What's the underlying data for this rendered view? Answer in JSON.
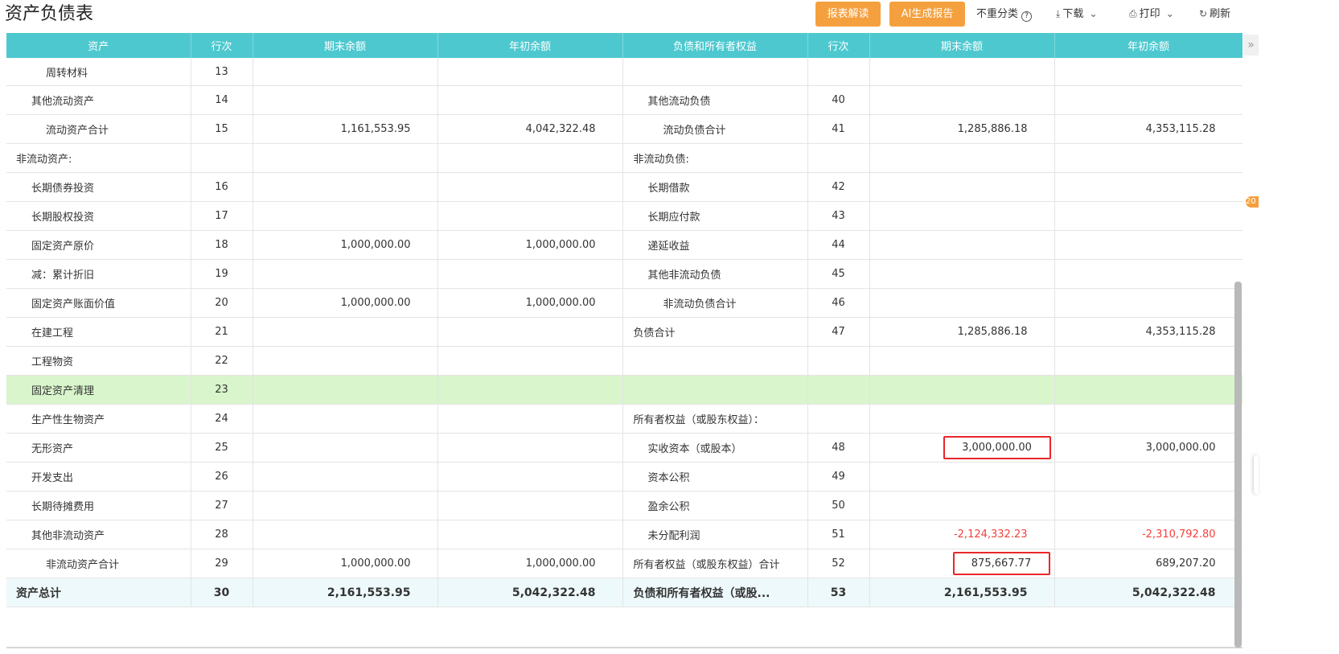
{
  "page": {
    "title": "资产负债表"
  },
  "toolbar": {
    "interpret": "报表解读",
    "ai_report": "AI生成报告",
    "no_reclass": "不重分类",
    "help_glyph": "?",
    "download": "下载",
    "print": "打印",
    "refresh": "刷新"
  },
  "side": {
    "badge": "20"
  },
  "table": {
    "headers": [
      "资产",
      "行次",
      "期末余额",
      "年初余额",
      "负债和所有者权益",
      "行次",
      "期末余额",
      "年初余额"
    ],
    "rows": [
      {
        "a": "周转材料",
        "al": "13",
        "ae": "",
        "ab": "",
        "l": "",
        "ll": "",
        "le": "",
        "lb": ""
      },
      {
        "a": "其他流动资产",
        "al": "14",
        "ae": "",
        "ab": "",
        "l": "其他流动负债",
        "ll": "40",
        "le": "",
        "lb": ""
      },
      {
        "a": "流动资产合计",
        "al": "15",
        "ae": "1,161,553.95",
        "ab": "4,042,322.48",
        "l": "流动负债合计",
        "ll": "41",
        "le": "1,285,886.18",
        "lb": "4,353,115.28"
      },
      {
        "a": "非流动资产:",
        "al": "",
        "ae": "",
        "ab": "",
        "l": "非流动负债:",
        "ll": "",
        "le": "",
        "lb": ""
      },
      {
        "a": "长期债券投资",
        "al": "16",
        "ae": "",
        "ab": "",
        "l": "长期借款",
        "ll": "42",
        "le": "",
        "lb": ""
      },
      {
        "a": "长期股权投资",
        "al": "17",
        "ae": "",
        "ab": "",
        "l": "长期应付款",
        "ll": "43",
        "le": "",
        "lb": ""
      },
      {
        "a": "固定资产原价",
        "al": "18",
        "ae": "1,000,000.00",
        "ab": "1,000,000.00",
        "l": "递延收益",
        "ll": "44",
        "le": "",
        "lb": ""
      },
      {
        "a": "减：累计折旧",
        "al": "19",
        "ae": "",
        "ab": "",
        "l": "其他非流动负债",
        "ll": "45",
        "le": "",
        "lb": ""
      },
      {
        "a": "固定资产账面价值",
        "al": "20",
        "ae": "1,000,000.00",
        "ab": "1,000,000.00",
        "l": "非流动负债合计",
        "ll": "46",
        "le": "",
        "lb": ""
      },
      {
        "a": "在建工程",
        "al": "21",
        "ae": "",
        "ab": "",
        "l": "负债合计",
        "ll": "47",
        "le": "1,285,886.18",
        "lb": "4,353,115.28"
      },
      {
        "a": "工程物资",
        "al": "22",
        "ae": "",
        "ab": "",
        "l": "",
        "ll": "",
        "le": "",
        "lb": ""
      },
      {
        "a": "固定资产清理",
        "al": "23",
        "ae": "",
        "ab": "",
        "l": "",
        "ll": "",
        "le": "",
        "lb": ""
      },
      {
        "a": "生产性生物资产",
        "al": "24",
        "ae": "",
        "ab": "",
        "l": "所有者权益（或股东权益）：",
        "ll": "",
        "le": "",
        "lb": ""
      },
      {
        "a": "无形资产",
        "al": "25",
        "ae": "",
        "ab": "",
        "l": "实收资本（或股本）",
        "ll": "48",
        "le": "3,000,000.00",
        "lb": "3,000,000.00"
      },
      {
        "a": "开发支出",
        "al": "26",
        "ae": "",
        "ab": "",
        "l": "资本公积",
        "ll": "49",
        "le": "",
        "lb": ""
      },
      {
        "a": "长期待摊费用",
        "al": "27",
        "ae": "",
        "ab": "",
        "l": "盈余公积",
        "ll": "50",
        "le": "",
        "lb": ""
      },
      {
        "a": "其他非流动资产",
        "al": "28",
        "ae": "",
        "ab": "",
        "l": "未分配利润",
        "ll": "51",
        "le": "-2,124,332.23",
        "lb": "-2,310,792.80"
      },
      {
        "a": "非流动资产合计",
        "al": "29",
        "ae": "1,000,000.00",
        "ab": "1,000,000.00",
        "l": "所有者权益（或股东权益）合计",
        "ll": "52",
        "le": "875,667.77",
        "lb": "689,207.20"
      },
      {
        "a": "资产总计",
        "al": "30",
        "ae": "2,161,553.95",
        "ab": "5,042,322.48",
        "l": "负债和所有者权益（或股...",
        "ll": "53",
        "le": "2,161,553.95",
        "lb": "5,042,322.48"
      }
    ]
  },
  "colors": {
    "header_bg": "#4ec8cf",
    "button_orange": "#f5a03e",
    "highlight_row": "#d8f5cc",
    "negative": "#f2403c",
    "annotation_box": "#e8262a"
  },
  "icons": [
    "help-circle-icon",
    "download-icon",
    "chevron-down-icon",
    "print-icon",
    "refresh-icon",
    "collapse-right-icon"
  ]
}
